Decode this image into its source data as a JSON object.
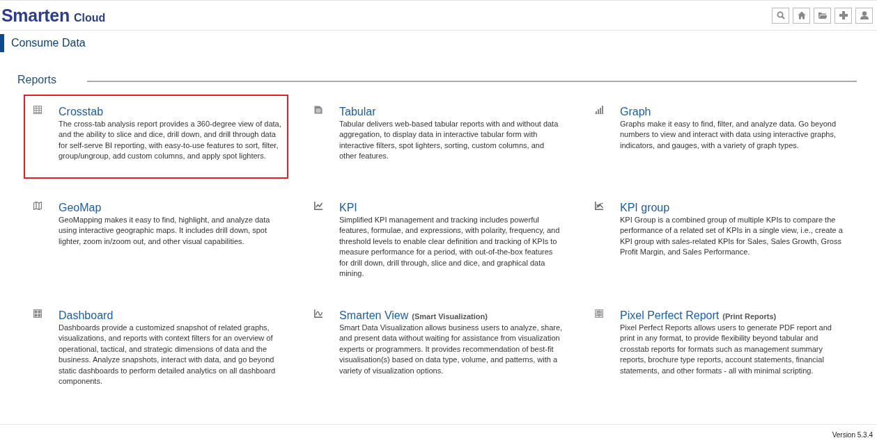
{
  "header": {
    "logo": {
      "brand": "Smarten",
      "product": "Cloud"
    },
    "toolbar": [
      {
        "kind": "search"
      },
      {
        "kind": "home"
      },
      {
        "kind": "folder"
      },
      {
        "kind": "add"
      },
      {
        "kind": "user"
      }
    ]
  },
  "page_title": "Consume Data",
  "section": {
    "title": "Reports",
    "cards": [
      {
        "kind": "crosstab",
        "title": "Crosstab",
        "selected": true,
        "description": "The cross-tab analysis report provides a 360-degree view of data, and the ability to slice and dice, drill down, and drill through data for self-serve BI reporting, with easy-to-use features to sort, filter, group/ungroup, add custom columns, and apply spot lighters."
      },
      {
        "kind": "tabular",
        "title": "Tabular",
        "selected": false,
        "description": "Tabular delivers web-based tabular reports with and without data aggregation, to display data in interactive tabular form with interactive filters, spot lighters, sorting, custom columns, and other features."
      },
      {
        "kind": "graph",
        "title": "Graph",
        "selected": false,
        "description": "Graphs make it easy to find, filter, and analyze data. Go beyond numbers to view and interact with data using interactive graphs, indicators, and gauges, with a variety of graph types."
      },
      {
        "kind": "geomap",
        "title": "GeoMap",
        "selected": false,
        "description": "GeoMapping makes it easy to find, highlight, and analyze data using interactive geographic maps. It includes drill down, spot lighter, zoom in/zoom out, and other visual capabilities."
      },
      {
        "kind": "kpi",
        "title": "KPI",
        "selected": false,
        "description": "Simplified KPI management and tracking includes powerful features, formulae, and expressions, with polarity, frequency, and threshold levels to enable clear definition and tracking of KPIs to measure performance for a period, with out-of-the-box features for drill down, drill through, slice and dice, and graphical data mining."
      },
      {
        "kind": "kpigroup",
        "title": "KPI group",
        "selected": false,
        "description": "KPI Group is a combined group of multiple KPIs to compare the performance of a related set of KPIs in a single view, i.e., create a KPI group with sales-related KPIs for Sales, Sales Growth, Gross Profit Margin, and Sales Performance."
      },
      {
        "kind": "dashboard",
        "title": "Dashboard",
        "selected": false,
        "description": "Dashboards provide a customized snapshot of related graphs, visualizations, and reports with context filters for an overview of operational, tactical, and strategic dimensions of data and the business. Analyze snapshots, interact with data, and go beyond static dashboards to perform detailed analytics on all dashboard components."
      },
      {
        "kind": "view",
        "title": "Smarten View",
        "subtitle": "(Smart Visualization)",
        "selected": false,
        "description": "Smart Data Visualization allows business users to analyze, share, and present data without waiting for assistance from visualization experts or programmers. It provides recommendation of best-fit visualisation(s) based on data type, volume, and patterns, with a variety of visualization options."
      },
      {
        "kind": "pixel",
        "title": "Pixel Perfect Report",
        "subtitle": "(Print Reports)",
        "selected": false,
        "description": "Pixel Perfect Reports allows users to generate PDF report and print in any format, to provide flexibility beyond tabular and crosstab reports for formats such as management summary reports, brochure type reports, account statements, financial statements, and other formats - all with minimal scripting."
      }
    ]
  },
  "footer": {
    "version": "Version 5.3.4"
  }
}
